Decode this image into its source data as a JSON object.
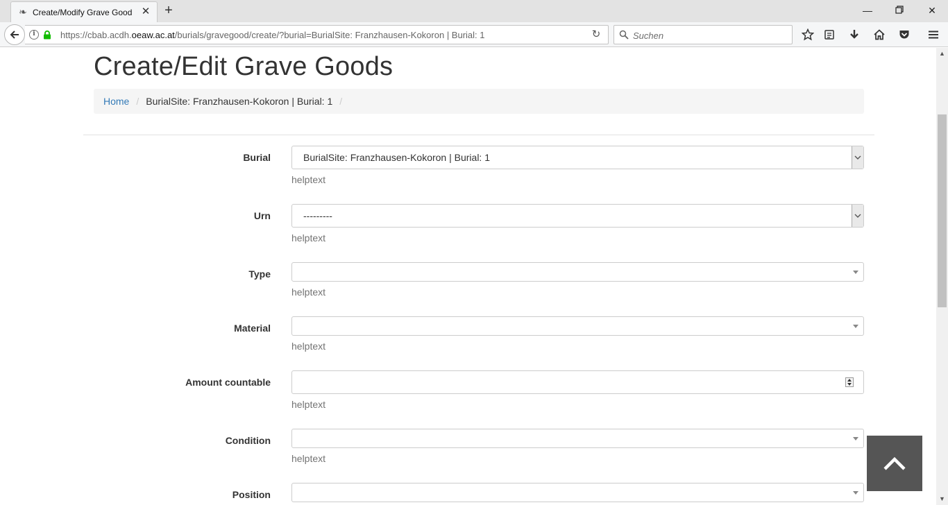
{
  "browser": {
    "tab_title": "Create/Modify Grave Good",
    "url_prefix": "https://cbab.acdh.",
    "url_domain": "oeaw.ac.at",
    "url_path": "/burials/gravegood/create/?burial=BurialSite: Franzhausen-Kokoron | Burial: 1",
    "search_placeholder": "Suchen",
    "favicon": "acdh-favicon",
    "icons": [
      "back-arrow-icon",
      "info-icon",
      "lock-icon",
      "reload-icon",
      "search-icon",
      "bookmark-star-icon",
      "reading-list-icon",
      "download-icon",
      "home-icon",
      "pocket-icon",
      "hamburger-menu-icon"
    ]
  },
  "page": {
    "title": "Create/Edit Grave Goods",
    "breadcrumb": {
      "home": "Home",
      "current": "BurialSite: Franzhausen-Kokoron | Burial: 1"
    }
  },
  "form": {
    "burial": {
      "label": "Burial",
      "value": "BurialSite: Franzhausen-Kokoron | Burial: 1",
      "help": "helptext"
    },
    "urn": {
      "label": "Urn",
      "value": "---------",
      "help": "helptext"
    },
    "type": {
      "label": "Type",
      "value": "",
      "help": "helptext"
    },
    "material": {
      "label": "Material",
      "value": "",
      "help": "helptext"
    },
    "amount": {
      "label": "Amount countable",
      "value": "",
      "help": "helptext"
    },
    "condition": {
      "label": "Condition",
      "value": "",
      "help": "helptext"
    },
    "position": {
      "label": "Position",
      "value": ""
    }
  },
  "colors": {
    "link": "#337ab7",
    "to_top_button": "#555555"
  }
}
